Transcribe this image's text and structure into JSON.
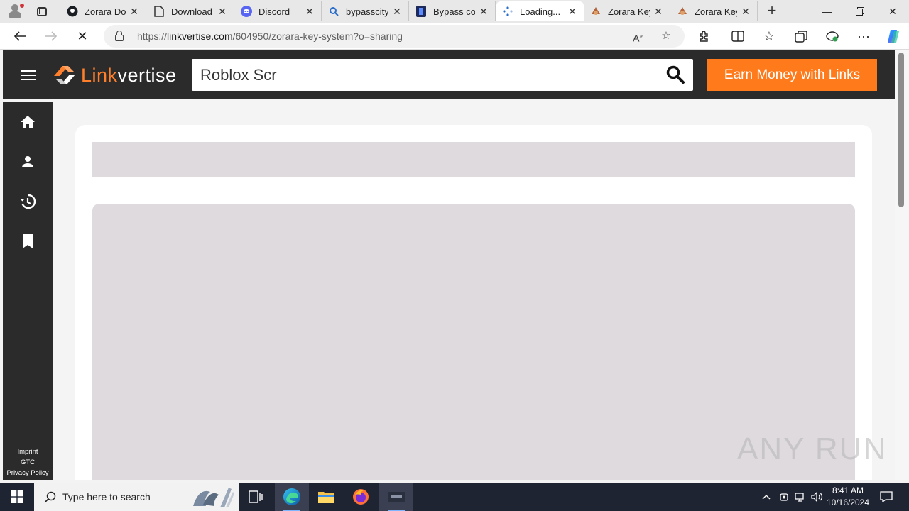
{
  "browser": {
    "tabs": [
      {
        "title": "Zorara Dow",
        "icon": "github-icon"
      },
      {
        "title": "Download",
        "icon": "page-icon"
      },
      {
        "title": "Discord",
        "icon": "discord-icon"
      },
      {
        "title": "bypasscity",
        "icon": "search-icon"
      },
      {
        "title": "Bypass cor",
        "icon": "bypass-icon"
      },
      {
        "title": "Loading...",
        "icon": "loading-icon",
        "active": true
      },
      {
        "title": "Zorara Key",
        "icon": "zorara-icon"
      },
      {
        "title": "Zorara Key",
        "icon": "zorara-icon"
      }
    ],
    "address": {
      "prefix": "https://",
      "host": "linkvertise.com",
      "path": "/604950/zorara-key-system?o=sharing"
    }
  },
  "site": {
    "logo_link": "Link",
    "logo_rest": "vertise",
    "search_value": "Roblox Scr",
    "earn_button": "Earn Money with Links",
    "nav": [
      "home-icon",
      "user-icon",
      "history-icon",
      "bookmark-icon"
    ],
    "footer_links": [
      "Imprint",
      "GTC",
      "Privacy Policy"
    ],
    "accent_color": "#ff7a1a"
  },
  "watermark": "ANY RUN",
  "taskbar": {
    "search_placeholder": "Type here to search",
    "time": "8:41 AM",
    "date": "10/16/2024"
  }
}
